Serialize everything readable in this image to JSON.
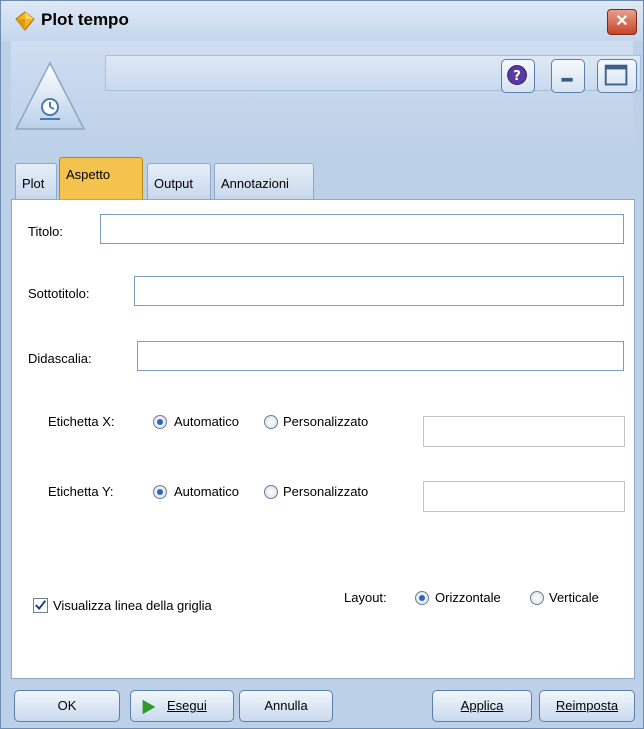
{
  "window": {
    "title": "Plot tempo"
  },
  "tabs": [
    {
      "label": "Plot"
    },
    {
      "label": "Aspetto"
    },
    {
      "label": "Output"
    },
    {
      "label": "Annotazioni"
    }
  ],
  "active_tab": "Aspetto",
  "form": {
    "titolo_label": "Titolo:",
    "titolo_value": "",
    "sottotitolo_label": "Sottotitolo:",
    "sottotitolo_value": "",
    "didascalia_label": "Didascalia:",
    "didascalia_value": "",
    "xlabel": {
      "label": "Etichetta X:",
      "option_auto": "Automatico",
      "option_custom": "Personalizzato",
      "selected": "Automatico",
      "value": ""
    },
    "ylabel": {
      "label": "Etichetta Y:",
      "option_auto": "Automatico",
      "option_custom": "Personalizzato",
      "selected": "Automatico",
      "value": ""
    },
    "grid_checkbox_label": "Visualizza linea della griglia",
    "grid_checked": true,
    "layout": {
      "label": "Layout:",
      "option_horizontal": "Orizzontale",
      "option_vertical": "Verticale",
      "selected": "Orizzontale"
    }
  },
  "buttons": {
    "ok": "OK",
    "run": "Esegui",
    "cancel": "Annulla",
    "apply": "Applica",
    "reset": "Reimposta"
  },
  "colors": {
    "active_tab": "#f3c34d",
    "window_bg": "#bcd0e8",
    "radio_selected": "#2a64c8",
    "run_arrow": "#2e9a2e"
  },
  "icons": [
    "app-diamond-icon",
    "close-icon",
    "time-plot-node-icon",
    "help-icon",
    "minimize-icon",
    "maximize-icon",
    "play-icon",
    "checkmark-icon"
  ]
}
